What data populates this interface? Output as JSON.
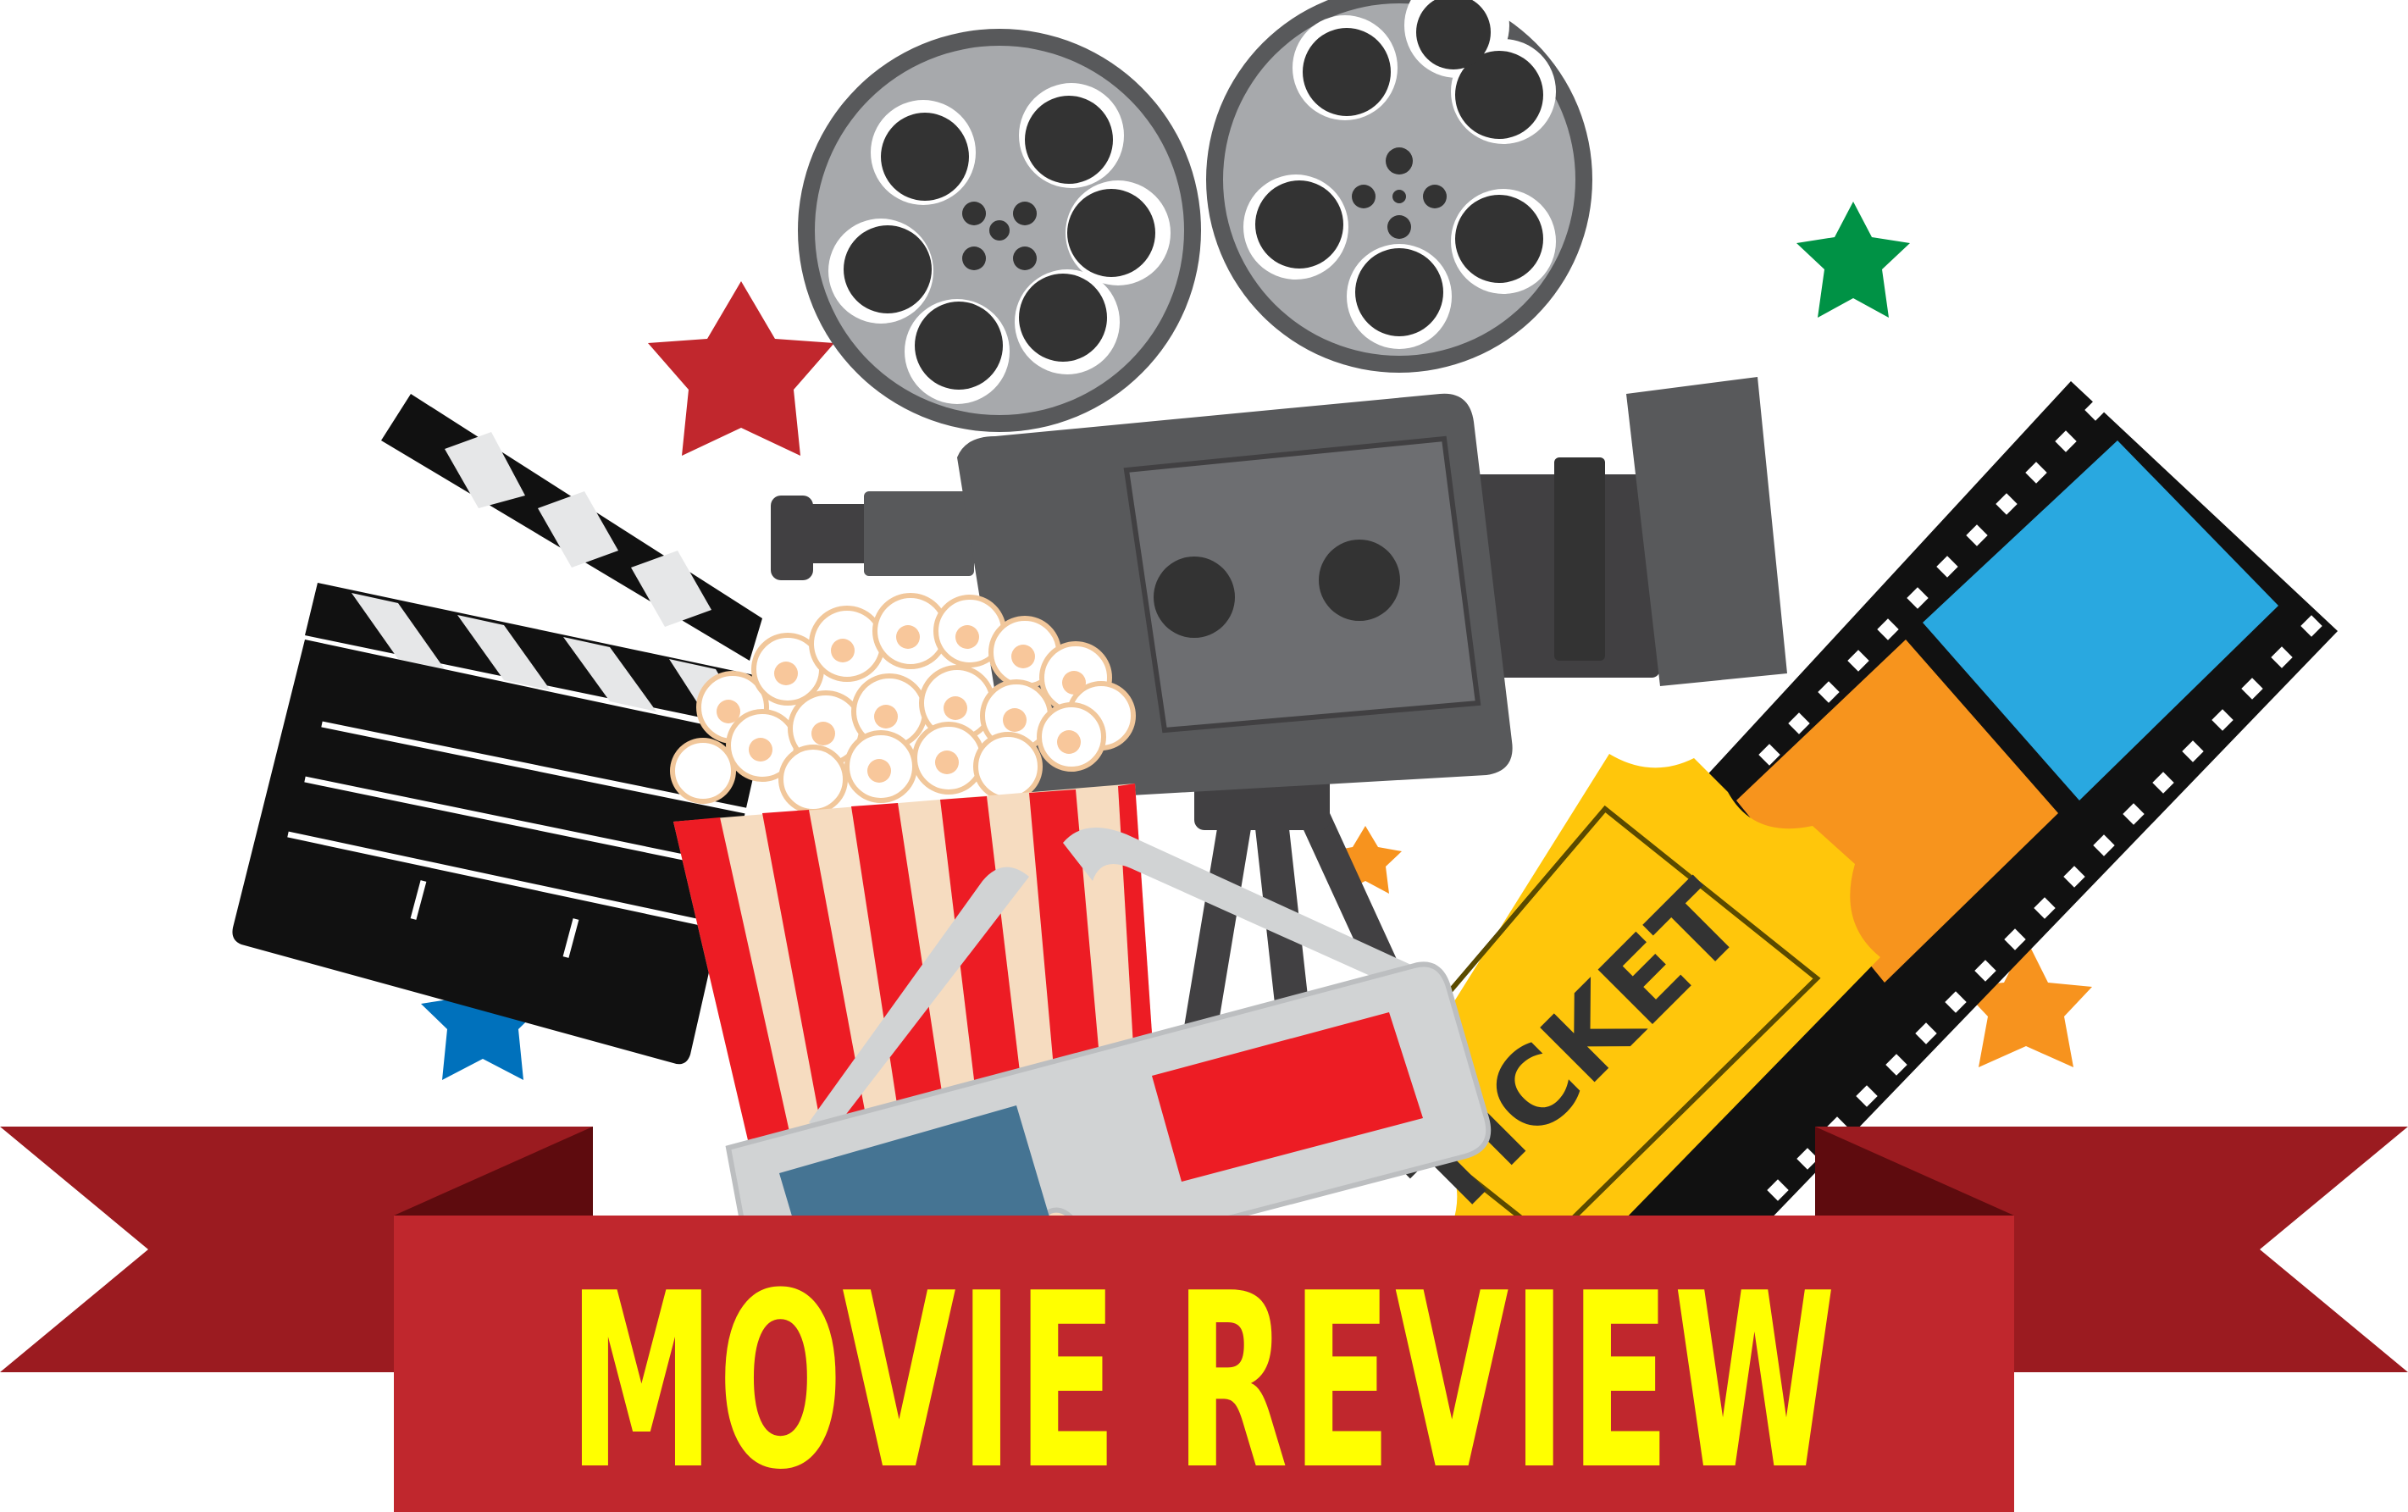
{
  "banner": {
    "title": "MOVIE REVIEW"
  },
  "ticket": {
    "label": "TICKET"
  },
  "colors": {
    "ribbon_front": "#c0272d",
    "ribbon_back": "#9b1b20",
    "ribbon_fold": "#5e0b0e",
    "title_text": "#ffff00",
    "reel_outer": "#a7a9ac",
    "camera_body": "#58595b",
    "camera_dark": "#414042",
    "clapper_black": "#111111",
    "popcorn_red": "#ed1c24",
    "popcorn_cream": "#f6dcc0",
    "ticket_yellow": "#ffc60b",
    "ticket_orange": "#f7941d",
    "film_blue": "#29a8e0",
    "glasses_blue": "#457493",
    "glasses_red": "#ed1c24",
    "star_red": "#c1272d",
    "star_green": "#009245",
    "star_blue": "#0071bc",
    "star_orange": "#f7931e"
  },
  "icons": {
    "projector": "film-projector-icon",
    "clapperboard": "clapperboard-icon",
    "popcorn": "popcorn-icon",
    "glasses": "3d-glasses-icon",
    "ticket": "ticket-icon",
    "film_strip": "film-strip-icon",
    "stars": "star-icon"
  }
}
